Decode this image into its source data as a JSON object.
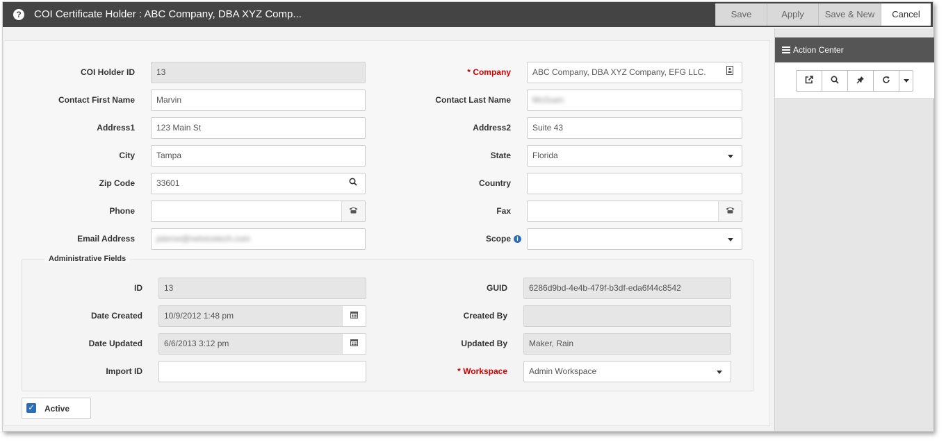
{
  "window": {
    "title": "COI Certificate Holder : ABC Company, DBA XYZ Comp..."
  },
  "toolbar": {
    "save": "Save",
    "apply": "Apply",
    "save_new": "Save & New",
    "cancel": "Cancel"
  },
  "form": {
    "coi_holder_id": {
      "label": "COI Holder ID",
      "value": "13"
    },
    "company": {
      "label": "Company",
      "required_mark": "* ",
      "value": "ABC Company, DBA XYZ Company, EFG LLC."
    },
    "contact_first_name": {
      "label": "Contact First Name",
      "value": "Marvin"
    },
    "contact_last_name": {
      "label": "Contact Last Name",
      "value": "McGuen"
    },
    "address1": {
      "label": "Address1",
      "value": "123 Main St"
    },
    "address2": {
      "label": "Address2",
      "value": "Suite 43"
    },
    "city": {
      "label": "City",
      "value": "Tampa"
    },
    "state": {
      "label": "State",
      "value": "Florida"
    },
    "zip_code": {
      "label": "Zip Code",
      "value": "33601"
    },
    "country": {
      "label": "Country",
      "value": ""
    },
    "phone": {
      "label": "Phone",
      "value": ""
    },
    "fax": {
      "label": "Fax",
      "value": ""
    },
    "email": {
      "label": "Email Address",
      "value": "jsterne@netvicetech.com"
    },
    "scope": {
      "label": "Scope",
      "value": ""
    }
  },
  "admin": {
    "legend": "Administrative Fields",
    "id": {
      "label": "ID",
      "value": "13"
    },
    "guid": {
      "label": "GUID",
      "value": "6286d9bd-4e4b-479f-b3df-eda6f44c8542"
    },
    "date_created": {
      "label": "Date Created",
      "value": "10/9/2012 1:48 pm"
    },
    "created_by": {
      "label": "Created By",
      "value": ""
    },
    "date_updated": {
      "label": "Date Updated",
      "value": "6/6/2013 3:12 pm"
    },
    "updated_by": {
      "label": "Updated By",
      "value": "Maker, Rain"
    },
    "import_id": {
      "label": "Import ID",
      "value": ""
    },
    "workspace": {
      "label": "Workspace",
      "required_mark": "* ",
      "value": "Admin Workspace"
    }
  },
  "active": {
    "label": "Active",
    "checked": true
  },
  "action_center": {
    "title": "Action Center"
  }
}
